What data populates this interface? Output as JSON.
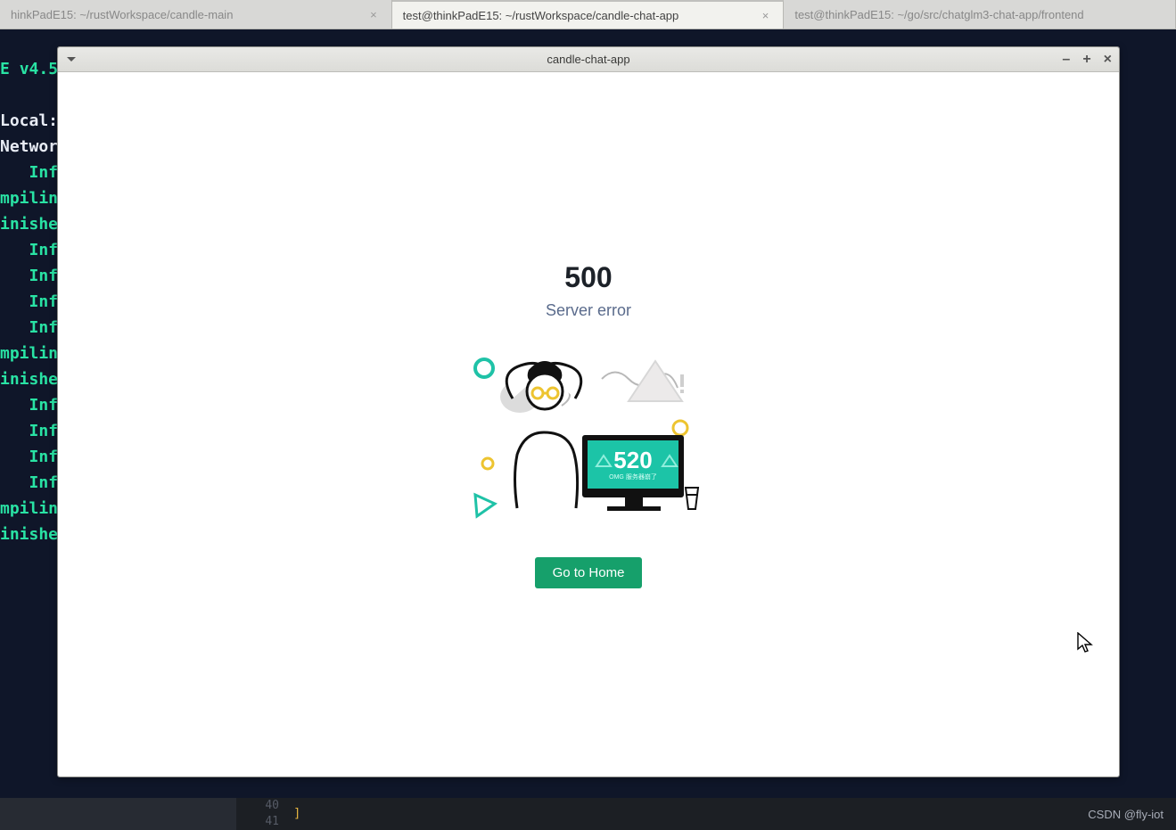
{
  "os_tabs": [
    {
      "title": "hinkPadE15: ~/rustWorkspace/candle-main",
      "active": false
    },
    {
      "title": "test@thinkPadE15: ~/rustWorkspace/candle-chat-app",
      "active": true
    },
    {
      "title": "test@thinkPadE15: ~/go/src/chatglm3-chat-app/frontend",
      "active": false
    }
  ],
  "terminal": {
    "version_prefix": "E ",
    "version": "v4.5",
    "local_label": "Local:",
    "network_label": "Networ",
    "lines": [
      "Inf",
      "mpilin",
      "inishe",
      "Inf",
      "Inf",
      "Inf",
      "Inf",
      "mpilin",
      "inishe",
      "Inf",
      "Inf",
      "Inf",
      "Inf",
      "mpilin",
      "inishe"
    ]
  },
  "app_window": {
    "title": "candle-chat-app",
    "error_code": "500",
    "error_message": "Server error",
    "screen_code": "520",
    "screen_sub": "OMG 服务器崩了",
    "home_button": "Go to Home"
  },
  "editor": {
    "line_nums": [
      "40",
      "41"
    ],
    "token": "]"
  },
  "watermark": "CSDN @fly-iot"
}
